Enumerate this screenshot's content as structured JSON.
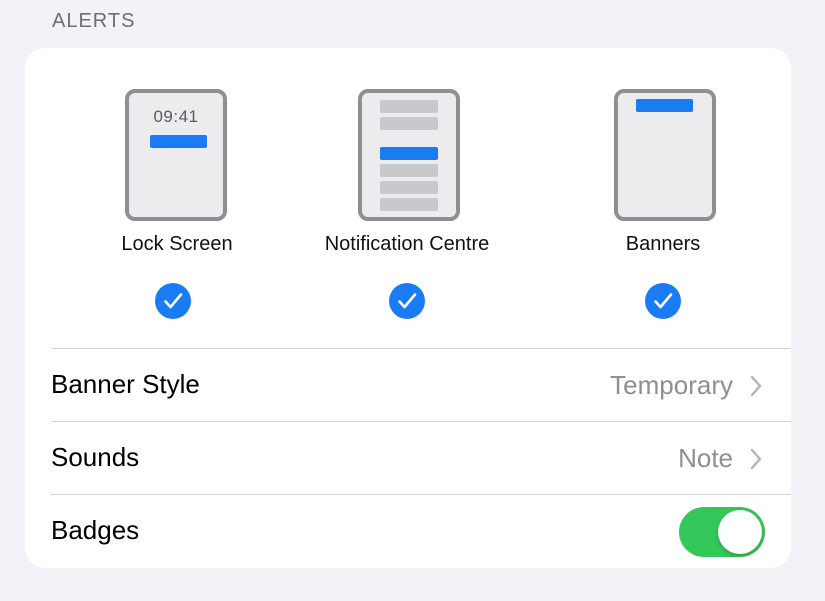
{
  "section_header": "ALERTS",
  "alert_options": [
    {
      "label": "Lock Screen",
      "time": "09:41",
      "checked": true
    },
    {
      "label": "Notification Centre",
      "checked": true
    },
    {
      "label": "Banners",
      "checked": true
    }
  ],
  "rows": {
    "banner_style": {
      "label": "Banner Style",
      "value": "Temporary"
    },
    "sounds": {
      "label": "Sounds",
      "value": "Note"
    },
    "badges": {
      "label": "Badges",
      "enabled": true
    }
  },
  "colors": {
    "accent": "#1a7cf5",
    "toggle_on": "#34c759",
    "background": "#f2f2f7"
  }
}
